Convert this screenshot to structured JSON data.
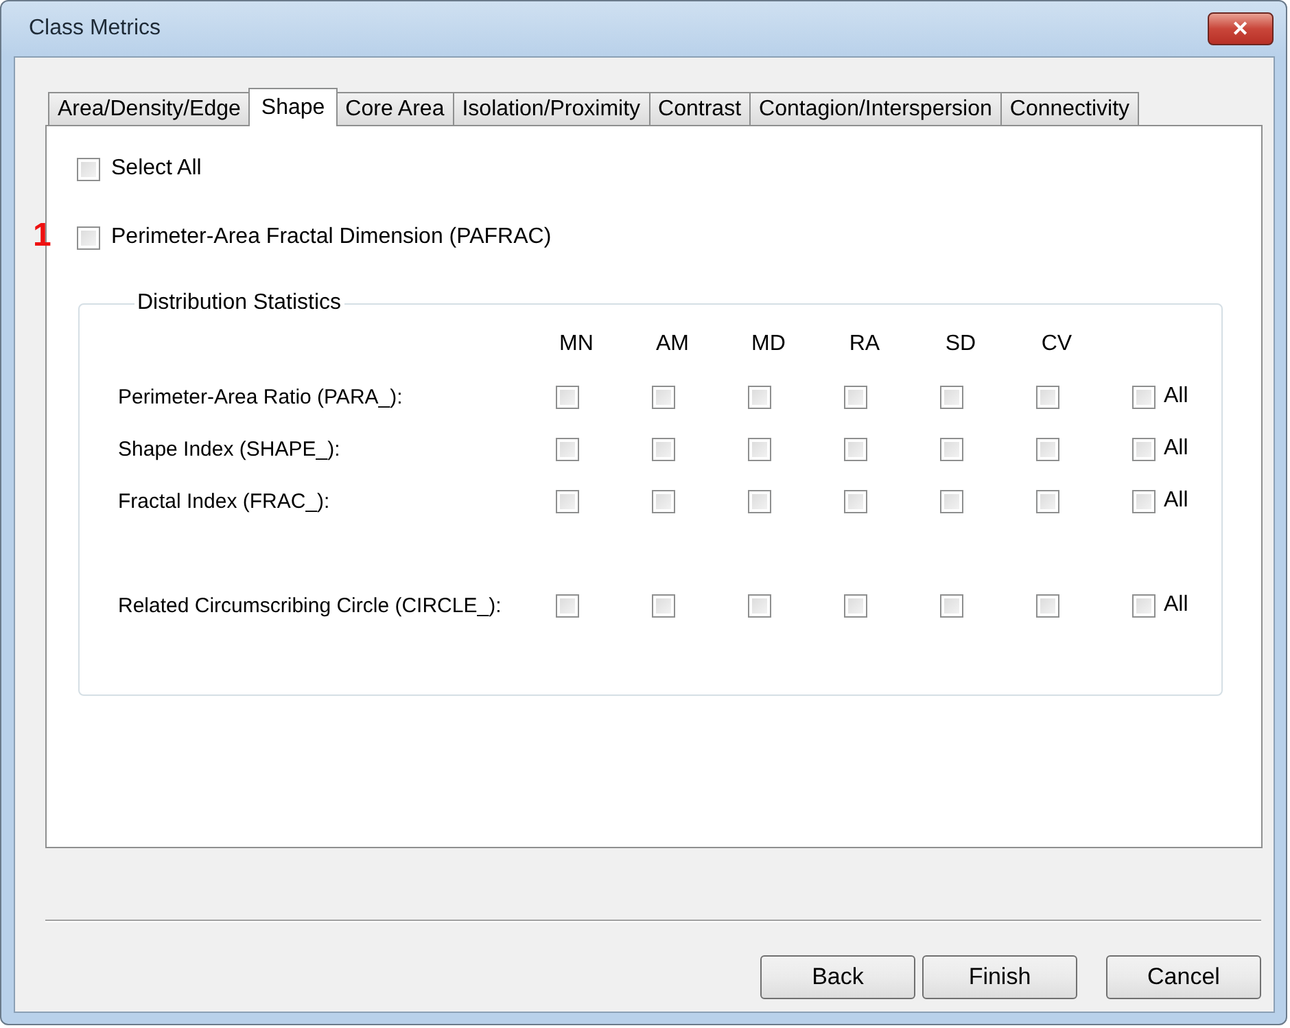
{
  "window": {
    "title": "Class Metrics",
    "close": "✕"
  },
  "tabs": [
    {
      "label": "Area/Density/Edge",
      "selected": false
    },
    {
      "label": "Shape",
      "selected": true
    },
    {
      "label": "Core Area",
      "selected": false
    },
    {
      "label": "Isolation/Proximity",
      "selected": false
    },
    {
      "label": "Contrast",
      "selected": false
    },
    {
      "label": "Contagion/Interspersion",
      "selected": false
    },
    {
      "label": "Connectivity",
      "selected": false
    }
  ],
  "select_all": {
    "label": "Select All",
    "checked": false
  },
  "pafrac": {
    "callout": "1",
    "label": "Perimeter-Area Fractal Dimension (PAFRAC)",
    "checked": false
  },
  "distribution": {
    "title": "Distribution Statistics",
    "columns": [
      "MN",
      "AM",
      "MD",
      "RA",
      "SD",
      "CV"
    ],
    "row_groups": [
      [
        {
          "label": "Perimeter-Area Ratio (PARA_):",
          "checks": [
            {
              "checked": false
            },
            {
              "checked": false
            },
            {
              "checked": false
            },
            {
              "checked": false
            },
            {
              "checked": false
            },
            {
              "checked": false
            }
          ],
          "all": {
            "label": "All",
            "checked": false
          }
        },
        {
          "label": "Shape Index (SHAPE_):",
          "checks": [
            {
              "checked": false
            },
            {
              "checked": false
            },
            {
              "checked": false
            },
            {
              "checked": false
            },
            {
              "checked": false
            },
            {
              "checked": false
            }
          ],
          "all": {
            "label": "All",
            "checked": false
          }
        },
        {
          "label": "Fractal Index (FRAC_):",
          "checks": [
            {
              "checked": false
            },
            {
              "checked": false
            },
            {
              "checked": false
            },
            {
              "checked": false
            },
            {
              "checked": false
            },
            {
              "checked": false
            }
          ],
          "all": {
            "label": "All",
            "checked": false
          }
        }
      ],
      [
        {
          "label": "Related Circumscribing Circle (CIRCLE_):",
          "checks": [
            {
              "checked": false
            },
            {
              "checked": false
            },
            {
              "checked": false
            },
            {
              "checked": false
            },
            {
              "checked": false
            },
            {
              "checked": false
            }
          ],
          "all": {
            "label": "All",
            "checked": false
          }
        }
      ]
    ]
  },
  "buttons": [
    {
      "label": "Back"
    },
    {
      "label": "Finish"
    },
    {
      "label": "Cancel"
    }
  ]
}
